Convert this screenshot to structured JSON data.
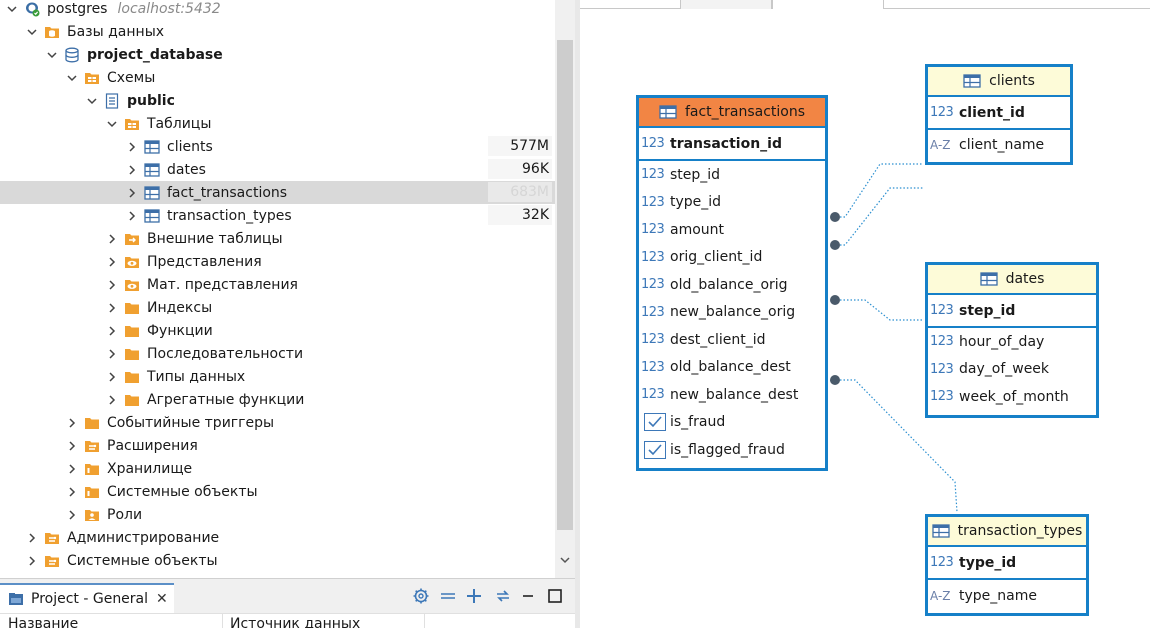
{
  "navigator": {
    "connection": {
      "name": "postgres",
      "host": "localhost:5432"
    },
    "databases_label": "Базы данных",
    "database_name": "project_database",
    "schemas_label": "Схемы",
    "schema_name": "public",
    "tables_label": "Таблицы",
    "tables": [
      {
        "name": "clients",
        "size": "577M"
      },
      {
        "name": "dates",
        "size": "96K"
      },
      {
        "name": "fact_transactions",
        "size": "683M"
      },
      {
        "name": "transaction_types",
        "size": "32K"
      }
    ],
    "schema_folders": [
      {
        "label": "Внешние таблицы",
        "icon": "foreign-table-icon"
      },
      {
        "label": "Представления",
        "icon": "view-icon"
      },
      {
        "label": "Мат. представления",
        "icon": "view-icon"
      },
      {
        "label": "Индексы",
        "icon": "folder-icon"
      },
      {
        "label": "Функции",
        "icon": "folder-icon"
      },
      {
        "label": "Последовательности",
        "icon": "folder-icon"
      },
      {
        "label": "Типы данных",
        "icon": "folder-icon"
      },
      {
        "label": "Агрегатные функции",
        "icon": "folder-icon"
      }
    ],
    "db_folders": [
      {
        "label": "Событийные триггеры",
        "icon": "folder-icon"
      },
      {
        "label": "Расширения",
        "icon": "extension-icon"
      },
      {
        "label": "Хранилище",
        "icon": "storage-icon"
      },
      {
        "label": "Системные объекты",
        "icon": "storage-icon"
      },
      {
        "label": "Роли",
        "icon": "roles-icon"
      }
    ],
    "conn_folders": [
      {
        "label": "Администрирование",
        "icon": "admin-icon"
      },
      {
        "label": "Системные объекты",
        "icon": "admin-icon"
      }
    ]
  },
  "project_panel": {
    "tab_label": "Project - General",
    "close_glyph": "✕",
    "columns": [
      "Название",
      "Источник данных"
    ]
  },
  "diagram": {
    "entities": {
      "fact_transactions": {
        "name": "fact_transactions",
        "pk": {
          "name": "transaction_id",
          "type": "123"
        },
        "columns": [
          {
            "name": "step_id",
            "type": "123"
          },
          {
            "name": "type_id",
            "type": "123"
          },
          {
            "name": "amount",
            "type": "123"
          },
          {
            "name": "orig_client_id",
            "type": "123"
          },
          {
            "name": "old_balance_orig",
            "type": "123"
          },
          {
            "name": "new_balance_orig",
            "type": "123"
          },
          {
            "name": "dest_client_id",
            "type": "123"
          },
          {
            "name": "old_balance_dest",
            "type": "123"
          },
          {
            "name": "new_balance_dest",
            "type": "123"
          },
          {
            "name": "is_fraud",
            "type": "bool"
          },
          {
            "name": "is_flagged_fraud",
            "type": "bool"
          }
        ]
      },
      "clients": {
        "name": "clients",
        "pk": {
          "name": "client_id",
          "type": "123"
        },
        "columns": [
          {
            "name": "client_name",
            "type": "A-Z"
          }
        ]
      },
      "dates": {
        "name": "dates",
        "pk": {
          "name": "step_id",
          "type": "123"
        },
        "columns": [
          {
            "name": "hour_of_day",
            "type": "123"
          },
          {
            "name": "day_of_week",
            "type": "123"
          },
          {
            "name": "week_of_month",
            "type": "123"
          }
        ]
      },
      "transaction_types": {
        "name": "transaction_types",
        "pk": {
          "name": "type_id",
          "type": "123"
        },
        "columns": [
          {
            "name": "type_name",
            "type": "A-Z"
          }
        ]
      }
    }
  },
  "colors": {
    "entity_border": "#1680c8",
    "fact_header": "#f28544",
    "dim_header": "#fdfbd8",
    "folder": "#f0a030",
    "selection": "#d9d9d9"
  }
}
